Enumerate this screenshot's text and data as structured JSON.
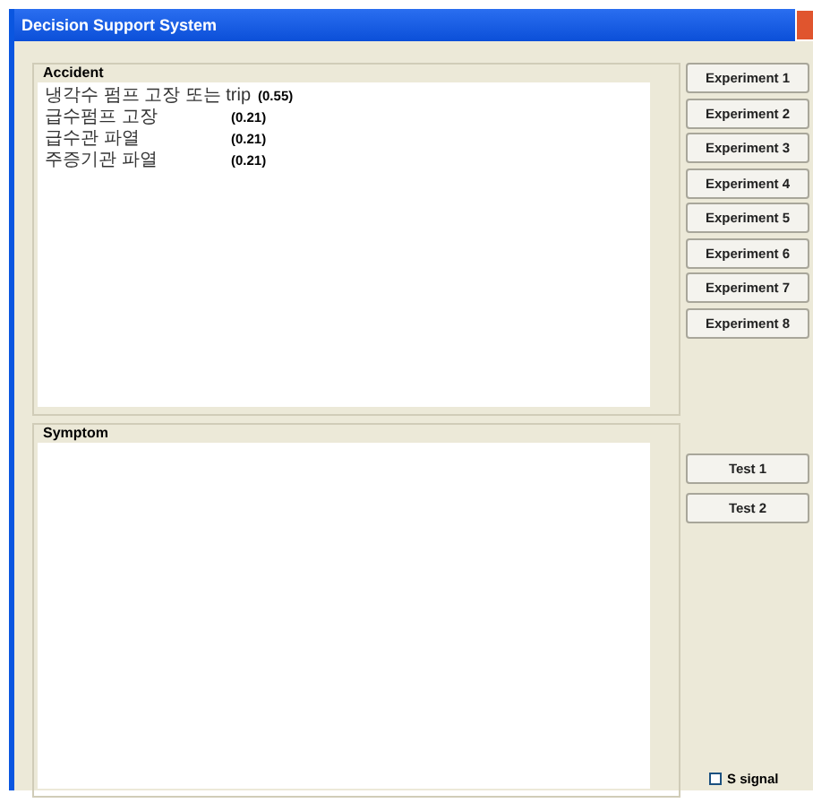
{
  "window": {
    "title": "Decision Support System"
  },
  "accident": {
    "label": "Accident",
    "items": [
      {
        "name": "냉각수 펌프 고장 또는 trip",
        "value": "(0.55)"
      },
      {
        "name": "급수펌프 고장",
        "value": "(0.21)"
      },
      {
        "name": "급수관 파열",
        "value": "(0.21)"
      },
      {
        "name": "주증기관 파열",
        "value": "(0.21)"
      }
    ]
  },
  "symptom": {
    "label": "Symptom"
  },
  "experiment_buttons": [
    "Experiment 1",
    "Experiment 2",
    "Experiment 3",
    "Experiment 4",
    "Experiment 5",
    "Experiment 6",
    "Experiment 7",
    "Experiment 8"
  ],
  "test_buttons": [
    "Test 1",
    "Test 2"
  ],
  "signal_checkbox": {
    "label": "S signal",
    "checked": false
  }
}
